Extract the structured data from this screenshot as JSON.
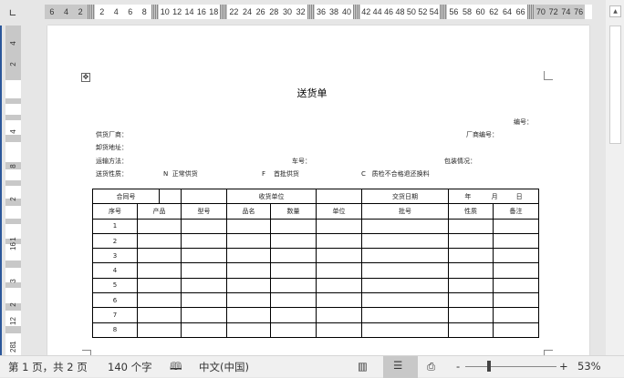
{
  "ruler": {
    "h_left_margin": [
      "6",
      "4",
      "2"
    ],
    "h_segments": [
      [
        "2",
        "4",
        "6",
        "8"
      ],
      [
        "10",
        "12",
        "14",
        "16",
        "18"
      ],
      [
        "22",
        "24",
        "26",
        "28",
        "30",
        "32"
      ],
      [
        "36",
        "38",
        "40"
      ],
      [
        "42",
        "44",
        "46",
        "48",
        "50",
        "52",
        "54"
      ],
      [
        "56",
        "58",
        "60",
        "62",
        "64",
        "66"
      ]
    ],
    "h_right_margin": [
      "70",
      "72",
      "74",
      "76"
    ],
    "v_labels": [
      "4",
      "2",
      "4",
      "8",
      "2",
      "1",
      "16",
      "3",
      "2",
      "12",
      "1",
      "28"
    ]
  },
  "document": {
    "title": "送货单",
    "serial_label": "编号：",
    "supplier_label": "供货厂商：",
    "vendor_no_label": "厂商编号：",
    "address_label": "卸货地址：",
    "transport_label": "运输方法：",
    "vehicle_label": "车号：",
    "packing_label": "包装情况：",
    "nature_label": "送货性质：",
    "options": [
      {
        "code": "N",
        "text": "正常供货"
      },
      {
        "code": "F",
        "text": "首批供货"
      },
      {
        "code": "C",
        "text": "质检不合格退还换料"
      }
    ],
    "table": {
      "row1": {
        "contract": "合同号",
        "receiver": "收货单位",
        "delivery_date": "交货日期",
        "year": "年",
        "month": "月",
        "day": "日"
      },
      "headers": [
        "序号",
        "产品",
        "型号",
        "品名",
        "数量",
        "单位",
        "批号",
        "性质",
        "备注"
      ],
      "rows": [
        "1",
        "2",
        "3",
        "4",
        "5",
        "6",
        "7",
        "8"
      ]
    }
  },
  "status": {
    "page": "第 1 页，共 2 页",
    "words": "140 个字",
    "language": "中文(中国)",
    "zoom_minus": "-",
    "zoom_plus": "+",
    "zoom": "53%",
    "zoom_value_percent": 53
  }
}
